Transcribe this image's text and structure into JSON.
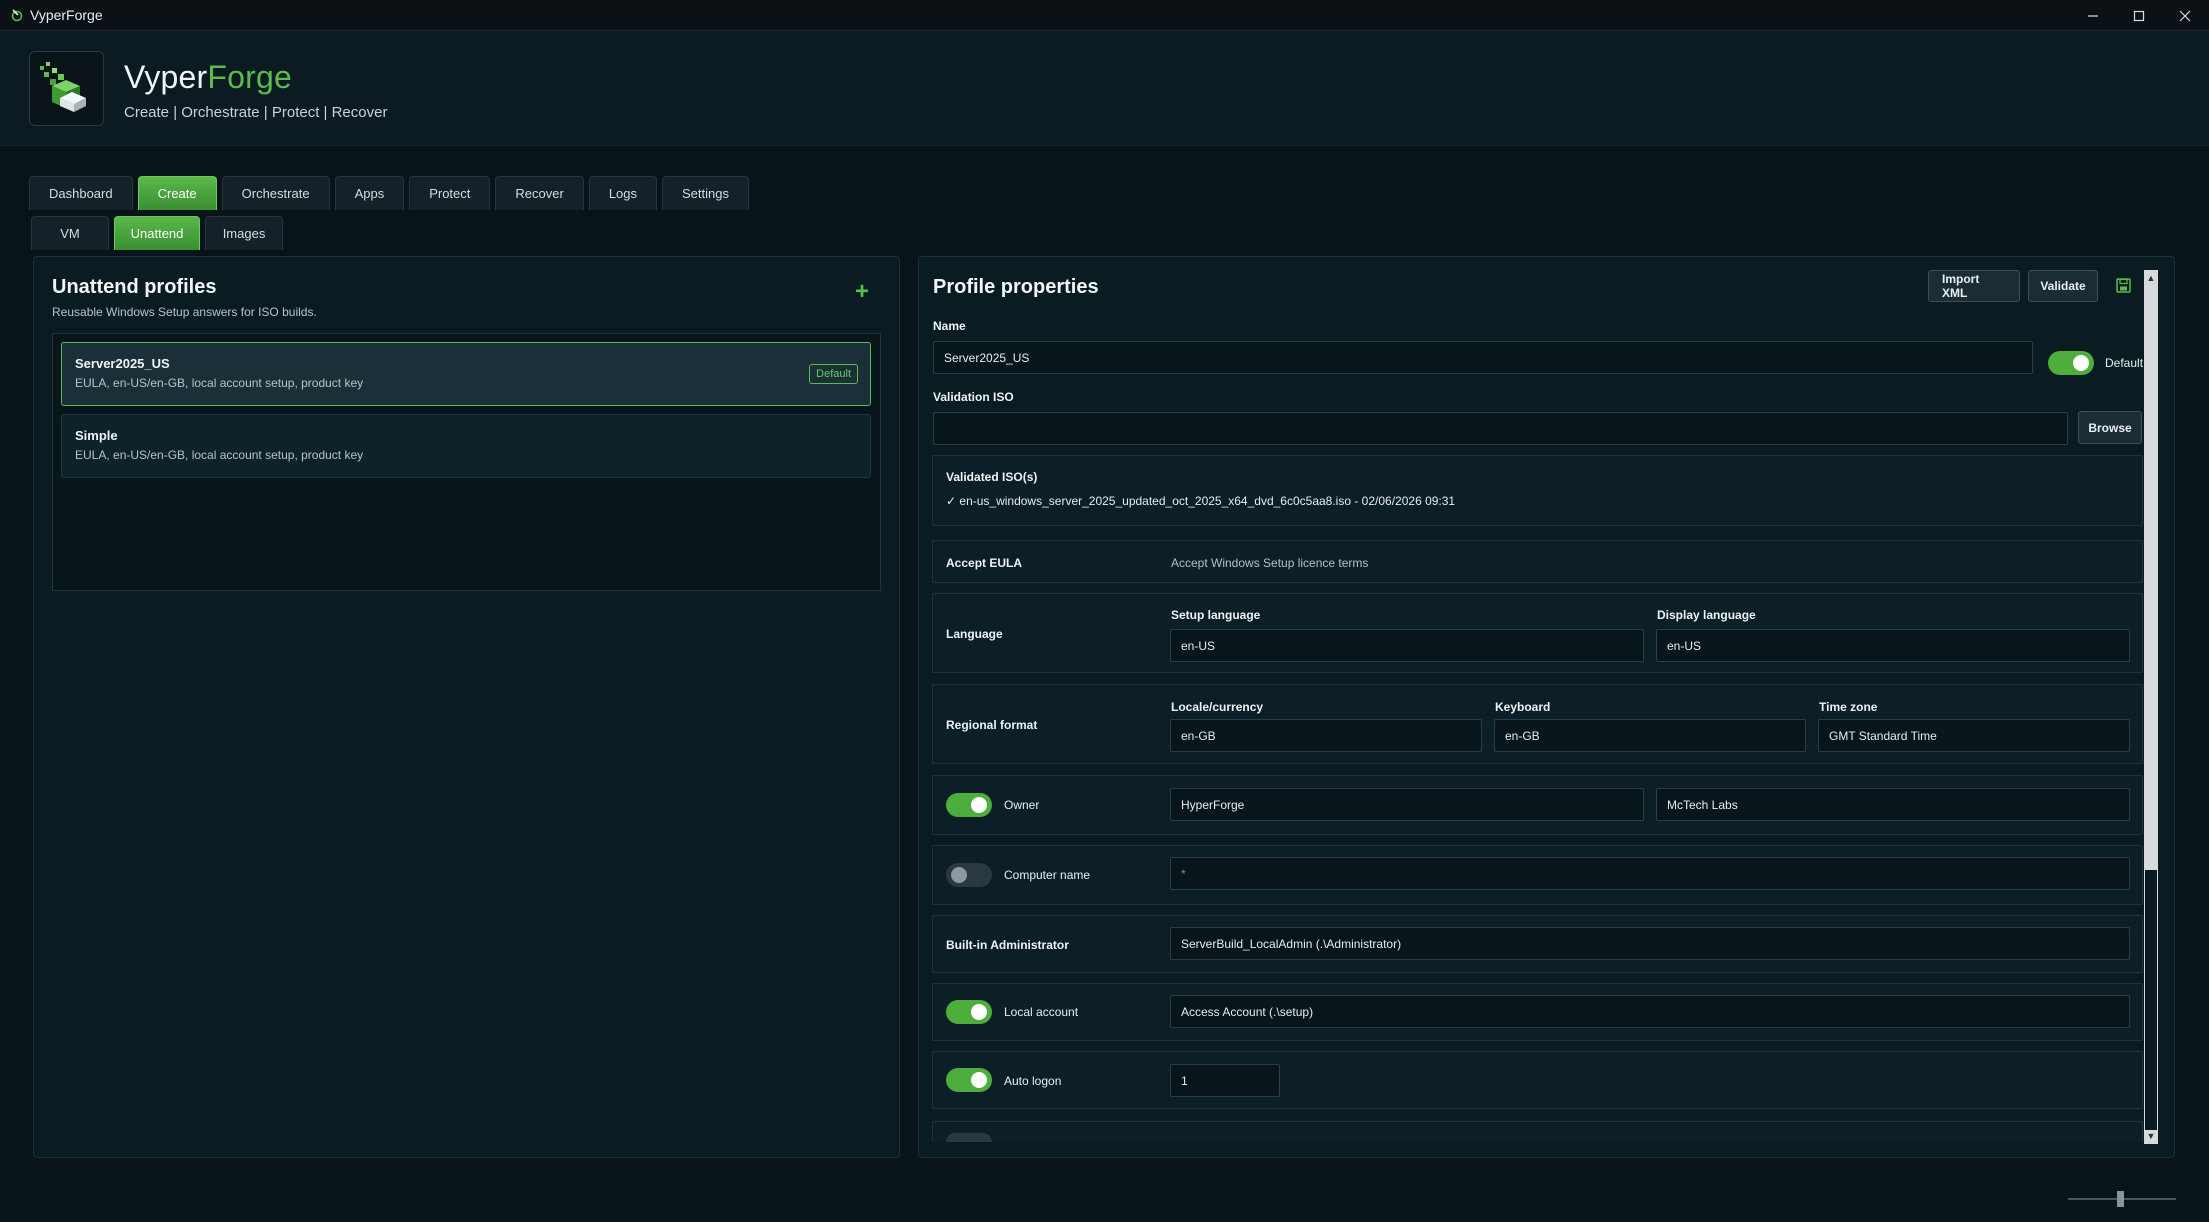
{
  "window": {
    "title": "VyperForge"
  },
  "header": {
    "brand_main": "Vyper",
    "brand_accent": "Forge",
    "tagline": "Create | Orchestrate | Protect | Recover"
  },
  "main_tabs": [
    "Dashboard",
    "Create",
    "Orchestrate",
    "Apps",
    "Protect",
    "Recover",
    "Logs",
    "Settings"
  ],
  "main_tab_active": "Create",
  "sub_tabs": [
    "VM",
    "Unattend",
    "Images"
  ],
  "sub_tab_active": "Unattend",
  "profiles_panel": {
    "title": "Unattend profiles",
    "subtitle": "Reusable Windows Setup answers for ISO builds.",
    "add_icon": "plus-icon",
    "items": [
      {
        "name": "Server2025_US",
        "desc": "EULA, en-US/en-GB, local account setup, product key",
        "badge": "Default",
        "selected": true
      },
      {
        "name": "Simple",
        "desc": "EULA, en-US/en-GB, local account setup, product key",
        "badge": "",
        "selected": false
      }
    ]
  },
  "properties": {
    "title": "Profile properties",
    "import_label": "Import XML",
    "validate_label": "Validate",
    "save_icon": "save-icon",
    "name_label": "Name",
    "name_value": "Server2025_US",
    "default_label": "Default",
    "default_on": true,
    "validation_iso_label": "Validation ISO",
    "validation_iso_value": "",
    "browse_label": "Browse",
    "validated_title": "Validated ISO(s)",
    "validated_entry": "✓ en-us_windows_server_2025_updated_oct_2025_x64_dvd_6c0c5aa8.iso - 02/06/2026 09:31",
    "eula_label": "Accept EULA",
    "eula_text": "Accept Windows Setup licence terms",
    "language_label": "Language",
    "setup_language_label": "Setup language",
    "setup_language_value": "en-US",
    "display_language_label": "Display language",
    "display_language_value": "en-US",
    "regional_label": "Regional format",
    "locale_label": "Locale/currency",
    "locale_value": "en-GB",
    "keyboard_label": "Keyboard",
    "keyboard_value": "en-GB",
    "timezone_label": "Time zone",
    "timezone_value": "GMT Standard Time",
    "owner_label": "Owner",
    "owner_on": true,
    "owner_name": "HyperForge",
    "owner_org": "McTech Labs",
    "computer_label": "Computer name",
    "computer_on": false,
    "computer_value": "*",
    "admin_label": "Built-in Administrator",
    "admin_value": "ServerBuild_LocalAdmin (.\\Administrator)",
    "local_label": "Local account",
    "local_on": true,
    "local_value": "Access Account (.\\setup)",
    "autologon_label": "Auto logon",
    "autologon_on": true,
    "autologon_value": "1"
  },
  "colors": {
    "accent": "#5dbb4d",
    "background": "#08141a",
    "panel": "#0a1b22"
  }
}
